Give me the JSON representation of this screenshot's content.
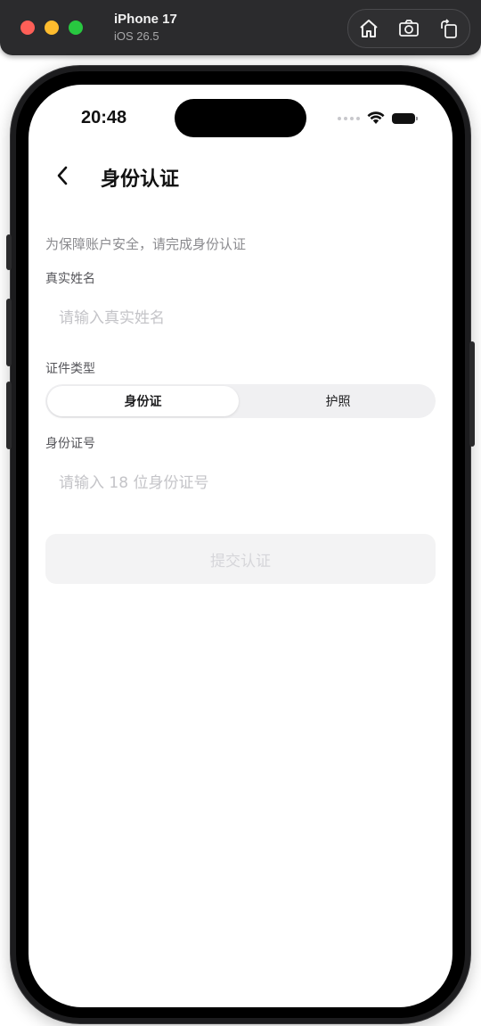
{
  "simulator": {
    "device_name": "iPhone 17",
    "os_version": "iOS 26.5",
    "tools": [
      "home-icon",
      "screenshot-icon",
      "rotate-icon"
    ]
  },
  "status_bar": {
    "time": "20:48",
    "icons": [
      "signal-icon",
      "wifi-icon",
      "battery-icon"
    ]
  },
  "nav": {
    "back_icon": "chevron-left-icon",
    "title": "身份认证"
  },
  "form": {
    "hint": "为保障账户安全，请完成身份认证",
    "name_label": "真实姓名",
    "name_value": "",
    "name_placeholder": "请输入真实姓名",
    "doc_type_label": "证件类型",
    "doc_types": [
      {
        "label": "身份证",
        "selected": true
      },
      {
        "label": "护照",
        "selected": false
      }
    ],
    "id_label": "身份证号",
    "id_value": "",
    "id_placeholder": "请输入 18 位身份证号",
    "submit_label": "提交认证",
    "submit_enabled": false
  },
  "colors": {
    "accent": "#111111",
    "hint_text": "#8a8a8e",
    "segment_bg": "#f0f0f2",
    "submit_disabled_bg": "#f3f3f4"
  }
}
